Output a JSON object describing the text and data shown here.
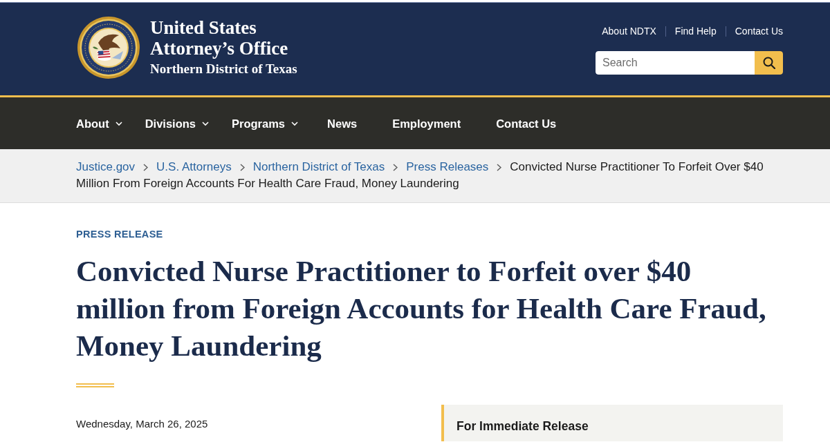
{
  "header": {
    "site_title": "United States Attorney’s Office",
    "site_subtitle": "Northern District of Texas",
    "utility_links": [
      "About NDTX",
      "Find Help",
      "Contact Us"
    ],
    "search": {
      "placeholder": "Search"
    }
  },
  "nav": [
    {
      "label": "About",
      "dropdown": true
    },
    {
      "label": "Divisions",
      "dropdown": true
    },
    {
      "label": "Programs",
      "dropdown": true
    },
    {
      "label": "News",
      "dropdown": false
    },
    {
      "label": "Employment",
      "dropdown": false
    },
    {
      "label": "Contact Us",
      "dropdown": false
    }
  ],
  "breadcrumb": [
    {
      "label": "Justice.gov",
      "kind": "link"
    },
    {
      "label": "U.S. Attorneys",
      "kind": "link"
    },
    {
      "label": "Northern District of Texas",
      "kind": "link"
    },
    {
      "label": "Press Releases",
      "kind": "link"
    },
    {
      "label": "Convicted Nurse Practitioner To Forfeit Over $40 Million From Foreign Accounts For Health Care Fraud, Money Laundering",
      "kind": "current"
    }
  ],
  "article": {
    "eyebrow": "PRESS RELEASE",
    "title": "Convicted Nurse Practitioner to Forfeit over $40 million from Foreign Accounts for Health Care Fraud, Money Laundering",
    "date": "Wednesday, March 26, 2025"
  },
  "aside": {
    "heading": "For Immediate Release"
  }
}
